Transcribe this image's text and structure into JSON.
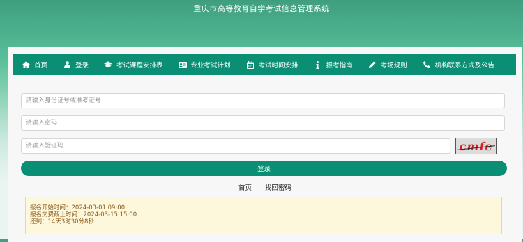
{
  "site_title": "重庆市高等教育自学考试信息管理系统",
  "nav": [
    {
      "label": "首页",
      "icon": "home-icon"
    },
    {
      "label": "登录",
      "icon": "user-icon"
    },
    {
      "label": "考试课程安排表",
      "icon": "graduation-cap-icon"
    },
    {
      "label": "专业考试计划",
      "icon": "id-card-icon"
    },
    {
      "label": "考试时间安排",
      "icon": "calendar-icon"
    },
    {
      "label": "报考指南",
      "icon": "info-icon"
    },
    {
      "label": "考场规则",
      "icon": "pencil-icon"
    },
    {
      "label": "机构联系方式及公告",
      "icon": "phone-icon"
    }
  ],
  "form": {
    "id_placeholder": "请输入身份证号或准考证号",
    "password_placeholder": "请输入密码",
    "captcha_placeholder": "请输入验证码",
    "captcha_text": "cmfe",
    "login_button": "登录"
  },
  "links": {
    "home": "首页",
    "recover_password": "找回密码"
  },
  "notice": {
    "line1": "报名开始时间：2024-03-01 09:00",
    "line2": "报名交费截止时间：2024-03-15 15:00",
    "line3": "还剩：14天3时30分8秒"
  },
  "colors": {
    "nav_bg": "#0b8f74",
    "header_gradient_top": "#3f9e7e",
    "notice_bg": "#fdf7dc",
    "captcha_text": "#d42020"
  }
}
